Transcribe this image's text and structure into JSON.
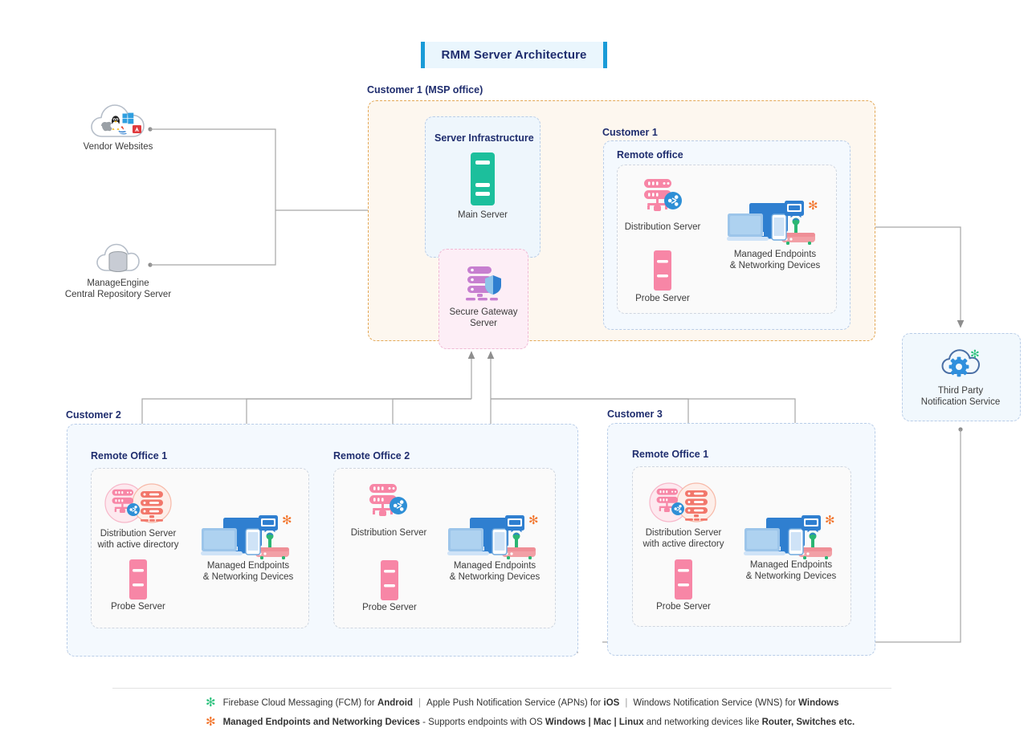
{
  "title": "RMM Server Architecture",
  "groups": {
    "msp": {
      "label": "Customer 1 (MSP office)"
    },
    "server_infra": {
      "label": "Server Infrastructure"
    },
    "customer1": {
      "label": "Customer 1",
      "office": "Remote office"
    },
    "customer2": {
      "label": "Customer 2",
      "office1": "Remote Office 1",
      "office2": "Remote Office 2"
    },
    "customer3": {
      "label": "Customer 3",
      "office1": "Remote Office 1"
    }
  },
  "nodes": {
    "vendor_websites": "Vendor Websites",
    "central_repo_line1": "ManageEngine",
    "central_repo_line2": "Central Repository Server",
    "main_server": "Main Server",
    "secure_gateway_line1": "Secure Gateway",
    "secure_gateway_line2": "Server",
    "distribution_server": "Distribution Server",
    "distribution_server_ad_line1": "Distribution Server",
    "distribution_server_ad_line2": "with active directory",
    "probe_server": "Probe Server",
    "managed_endpoints_line1": "Managed Endpoints",
    "managed_endpoints_line2": "& Networking Devices",
    "third_party_line1": "Third Party",
    "third_party_line2": "Notification Service"
  },
  "legend": {
    "row1": {
      "marker": "green-asterisk-icon",
      "marker_glyph": "✻",
      "color": "#2ec27e",
      "parts": [
        {
          "text": "Firebase Cloud Messaging (FCM) for ",
          "bold": false
        },
        {
          "text": "Android",
          "bold": true
        },
        {
          "text": "|",
          "sep": true
        },
        {
          "text": "Apple Push Notification Service (APNs) for ",
          "bold": false
        },
        {
          "text": "iOS",
          "bold": true
        },
        {
          "text": "|",
          "sep": true
        },
        {
          "text": "Windows Notification Service (WNS) for ",
          "bold": false
        },
        {
          "text": "Windows",
          "bold": true
        }
      ]
    },
    "row2": {
      "marker": "orange-asterisk-icon",
      "marker_glyph": "✻",
      "color": "#f2762e",
      "parts": [
        {
          "text": "Managed Endpoints and Networking Devices",
          "bold": true
        },
        {
          "text": " - Supports endpoints with OS ",
          "bold": false
        },
        {
          "text": " Windows | Mac | Linux",
          "bold": true
        },
        {
          "text": " and networking devices like ",
          "bold": false
        },
        {
          "text": "Router, Switches etc.",
          "bold": true
        }
      ]
    }
  },
  "colors": {
    "title_text": "#1f2d6e",
    "title_bg": "#eaf6fd",
    "title_accent": "#1a9bd7",
    "msp_border": "#e3a857",
    "msp_fill": "#fdf7ef",
    "blue_border": "#b9cde8",
    "blue_fill": "#f4f9fe",
    "main_server": "#1cbf9c",
    "gateway_rack": "#c77fd0",
    "pink_rack": "#f786a6",
    "share_badge": "#2e8fd6",
    "endpoint_blue": "#2f7fd0",
    "asterisk_orange": "#f2762e",
    "asterisk_green": "#2ec27e",
    "wire": "#a6a6a6"
  }
}
